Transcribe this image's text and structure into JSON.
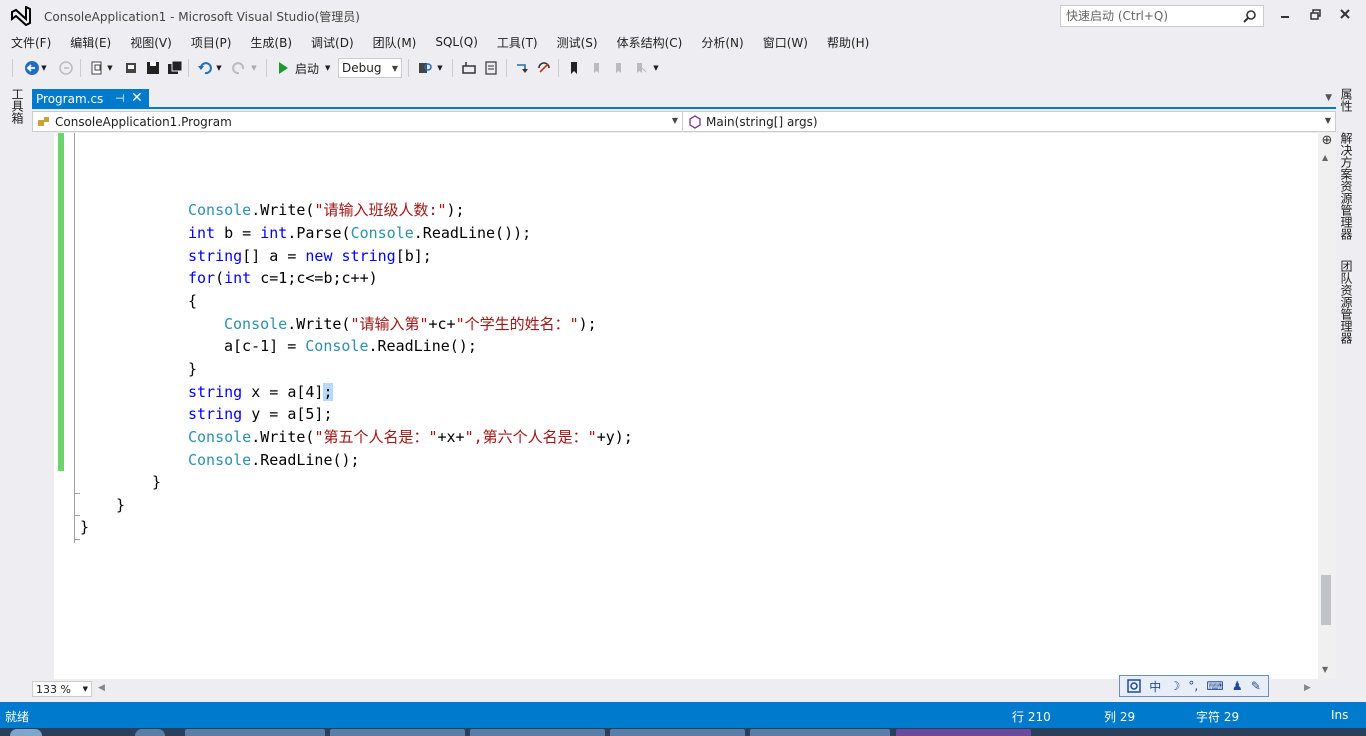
{
  "window": {
    "title": "ConsoleApplication1 - Microsoft Visual Studio(管理员)",
    "quick_launch_placeholder": "快速启动 (Ctrl+Q)"
  },
  "menu": [
    "文件(F)",
    "编辑(E)",
    "视图(V)",
    "项目(P)",
    "生成(B)",
    "调试(D)",
    "团队(M)",
    "SQL(Q)",
    "工具(T)",
    "测试(S)",
    "体系结构(C)",
    "分析(N)",
    "窗口(W)",
    "帮助(H)"
  ],
  "toolbar": {
    "start_label": "启动",
    "config_value": "Debug"
  },
  "side_panels": {
    "toolbox": "工具箱",
    "properties": "属性",
    "solution_explorer": "解决方案资源管理器",
    "team_explorer": "团队资源管理器"
  },
  "editor": {
    "tab_label": "Program.cs",
    "nav_class": "ConsoleApplication1.Program",
    "nav_member": "Main(string[] args)",
    "zoom": "133 %"
  },
  "ime": [
    "中",
    "☽",
    "°,",
    "⌨",
    "♟",
    "✎"
  ],
  "status": {
    "ready": "就绪",
    "line": "行 210",
    "col": "列 29",
    "char": "字符 29",
    "mode": "Ins"
  },
  "accent_color": "#007acc"
}
